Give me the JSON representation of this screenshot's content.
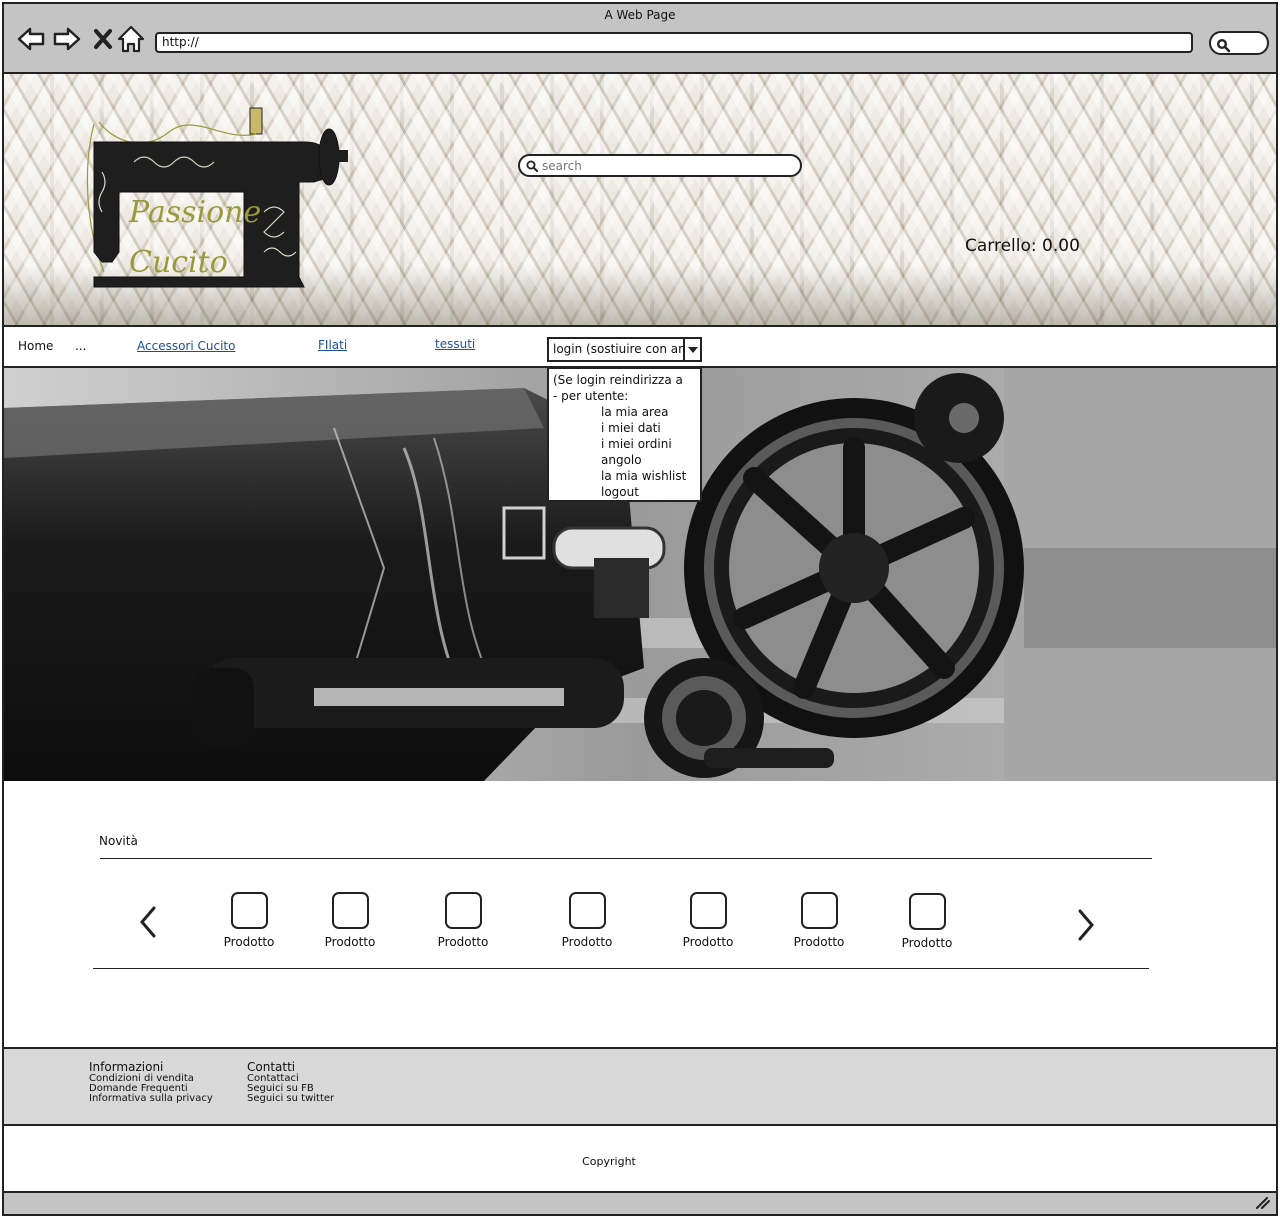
{
  "browser": {
    "title": "A Web Page",
    "url": "http://"
  },
  "header": {
    "logo_text_1": "Passione",
    "logo_text_2": "Cucito",
    "search_placeholder": "search",
    "cart": "Carrello: 0.00"
  },
  "nav": {
    "home": "Home",
    "ellipsis": "...",
    "accessori": "Accessori Cucito",
    "filati": "FIlati",
    "tessuti": "tessuti",
    "login": "login (sostiuire con area utente)"
  },
  "dropdown": {
    "items": [
      "(Se login reindirizza a",
      "- per utente:",
      "la mia area",
      "i miei dati",
      "i miei ordini",
      "angolo",
      "la mia wishlist",
      "logout"
    ]
  },
  "novita": {
    "title": "Novità",
    "products": [
      "Prodotto",
      "Prodotto",
      "Prodotto",
      "Prodotto",
      "Prodotto",
      "Prodotto",
      "Prodotto"
    ]
  },
  "footer": {
    "info_title": "Informazioni",
    "info_links": [
      "Condizioni di vendita",
      "Domande Frequenti",
      "Informativa sulla privacy"
    ],
    "contact_title": "Contatti",
    "contact_links": [
      "Contattaci",
      "Seguici su FB",
      "Seguici su twitter"
    ],
    "copyright": "Copyright"
  }
}
